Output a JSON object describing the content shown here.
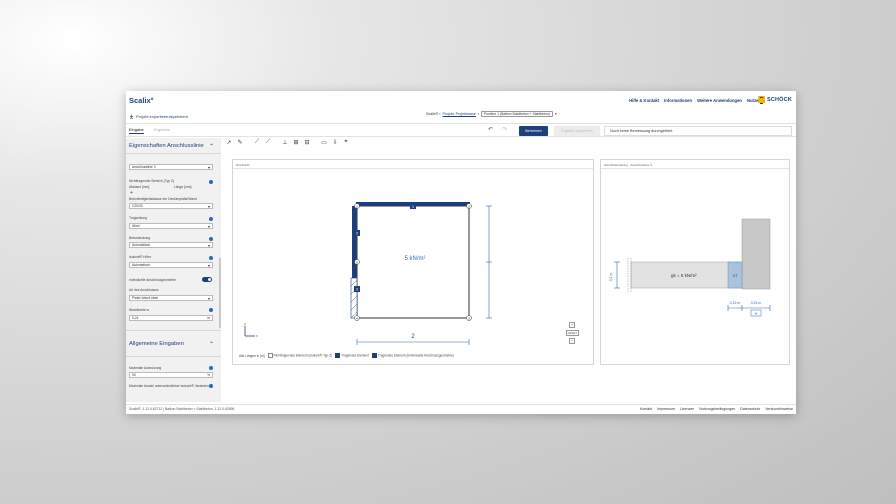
{
  "header": {
    "logo": "Scalix°",
    "nav": [
      "Hilfe & Kontakt",
      "Informationen",
      "Weitere Anwendungen",
      "Nutzer"
    ],
    "brand": "SCHÖCK",
    "export_label": "Projekt exportieren/speichern"
  },
  "breadcrumb": {
    "root": "Scalix® •",
    "project": "Projekt: Projektname",
    "separator": "•",
    "position": "Position 1 (Balkon Stahlbeton + Stahlbeton)"
  },
  "tabs": {
    "input": "Eingabe",
    "results": "Ergebnis"
  },
  "actions": {
    "calculate": "Berechnen",
    "export": "Ergebnis exportieren",
    "status": "Noch keine Bemessung durchgeführt"
  },
  "sidebar": {
    "section1_title": "Eigenschaften Anschlusslinie",
    "line_select": "Anschlusslinie 3",
    "nontrag_label": "Nichttragender Bereich (Typ Z)",
    "abstand_label": "Abstand [mm]",
    "laenge_label": "Länge [mm]",
    "plus": "+",
    "concrete_label": "Betonfestigkeitsklasse der Deckenplatte/Wand",
    "concrete_value": "C25/30",
    "tragwirkung_label": "Tragwirkung",
    "tragwirkung_value": "Wind",
    "betondeckung_label": "Betondeckung",
    "betondeckung_value": "Automatisch",
    "isokorb_label": "Isokorb® Höhe",
    "isokorb_value": "Automatisch",
    "individual_label": "Individuelle Anschlussgeometrie",
    "art_label": "Art des Anschlusses",
    "art_value": "Platte-Wand oben",
    "wandbreite_label": "Wandbreite w",
    "wandbreite_value": "0,24",
    "wandbreite_unit": "m",
    "section2_title": "Allgemeine Eingaben",
    "ausnutzung_label": "Maximale Ausnutzung",
    "ausnutzung_value": "90",
    "ausnutzung_unit": "%",
    "varianten_label": "Maximale Anzahl unterschiedlicher Isokorb® Varianten"
  },
  "draufsicht": {
    "title": "Draufsicht",
    "load": "5 kN/m²",
    "dim_bottom": "2",
    "edge_labels": [
      "1",
      "2",
      "3"
    ],
    "node_labels": [
      "1",
      "2",
      "3",
      "4",
      "5"
    ],
    "axis_x": "x",
    "axis_y": "y",
    "legend_units": "Alle Längen in [m]",
    "legend_items": [
      "Nichttragendes Element (Isokorb® Typ Z)",
      "Tragendes Element",
      "Tragendes Element (Individuelle Anschlussgeometrie)"
    ],
    "reset": "RESET"
  },
  "schnitt": {
    "title": "Schnittdarstellung - Anschlusslinie 3",
    "load": "gk = 5 kN/m²",
    "xt": "XT",
    "dim_left": "0,2 m",
    "dim_a": "0,12 m",
    "dim_b": "0,24 m",
    "w": "w"
  },
  "footer": {
    "version": "Scalix®, 1.12.0.62712 | Balkon Stahlbeton + Stahlbeton, 1.12.0.62696",
    "links": [
      "Kontakt",
      "Impressum",
      "Lizenzen",
      "Nutzungsbedingungen",
      "Datenschutz",
      "Versionshinweise"
    ]
  },
  "colors": {
    "primary": "#1d3f7a",
    "accent": "#f2b400",
    "link": "#2b6cb0"
  }
}
